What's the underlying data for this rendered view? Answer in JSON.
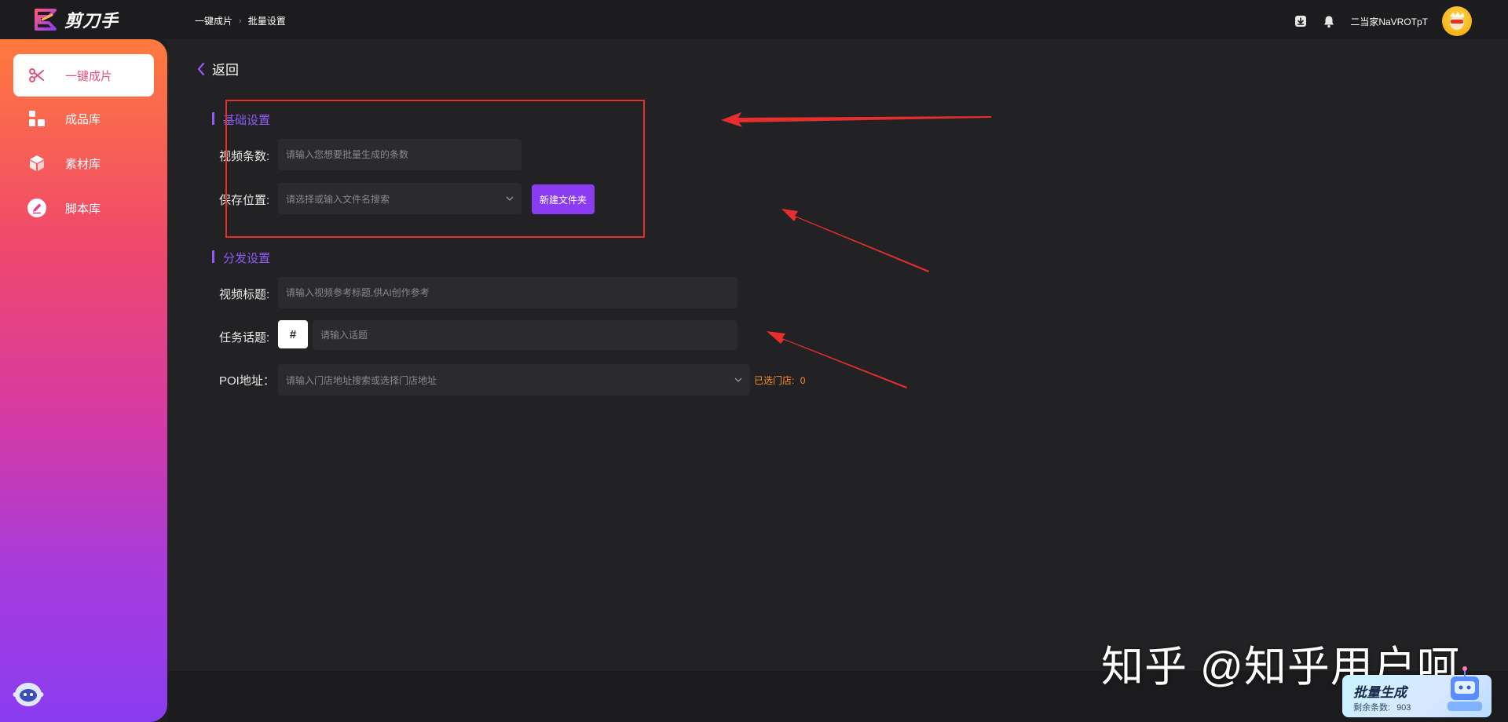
{
  "app": {
    "name": "剪刀手"
  },
  "breadcrumb": [
    "一键成片",
    "批量设置"
  ],
  "header": {
    "username": "二当家NaVROTpT",
    "icons": [
      "download-icon",
      "bell-icon"
    ]
  },
  "sidebar": {
    "items": [
      {
        "label": "一键成片",
        "icon": "scissors-icon",
        "active": true
      },
      {
        "label": "成品库",
        "icon": "blocks-icon",
        "active": false
      },
      {
        "label": "素材库",
        "icon": "cube-icon",
        "active": false
      },
      {
        "label": "脚本库",
        "icon": "pen-icon",
        "active": false
      }
    ]
  },
  "back": {
    "label": "返回"
  },
  "basic_settings": {
    "title": "基础设置",
    "video_count": {
      "label": "视频条数:",
      "placeholder": "请输入您想要批量生成的条数"
    },
    "save_location": {
      "label": "保存位置:",
      "placeholder": "请选择或输入文件名搜索"
    },
    "new_folder_button": "新建文件夹"
  },
  "distribution_settings": {
    "title": "分发设置",
    "video_title": {
      "label": "视频标题:",
      "placeholder": "请输入视频参考标题,供AI创作参考"
    },
    "task_topic": {
      "label": "任务话题:",
      "hash": "#",
      "placeholder": "请输入话题"
    },
    "poi": {
      "label": "POI地址：",
      "placeholder": "请输入门店地址搜索或选择门店地址",
      "selected_label": "已选门店:",
      "selected_count": "0"
    }
  },
  "watermark": "知乎 @知乎用户呵",
  "batch_card": {
    "title": "批量生成",
    "remaining_label": "剩余条数:",
    "remaining_value": "903"
  },
  "colors": {
    "accent": "#8b3cf3",
    "annotation": "#e62e2e",
    "warning": "#ff8c2a"
  }
}
